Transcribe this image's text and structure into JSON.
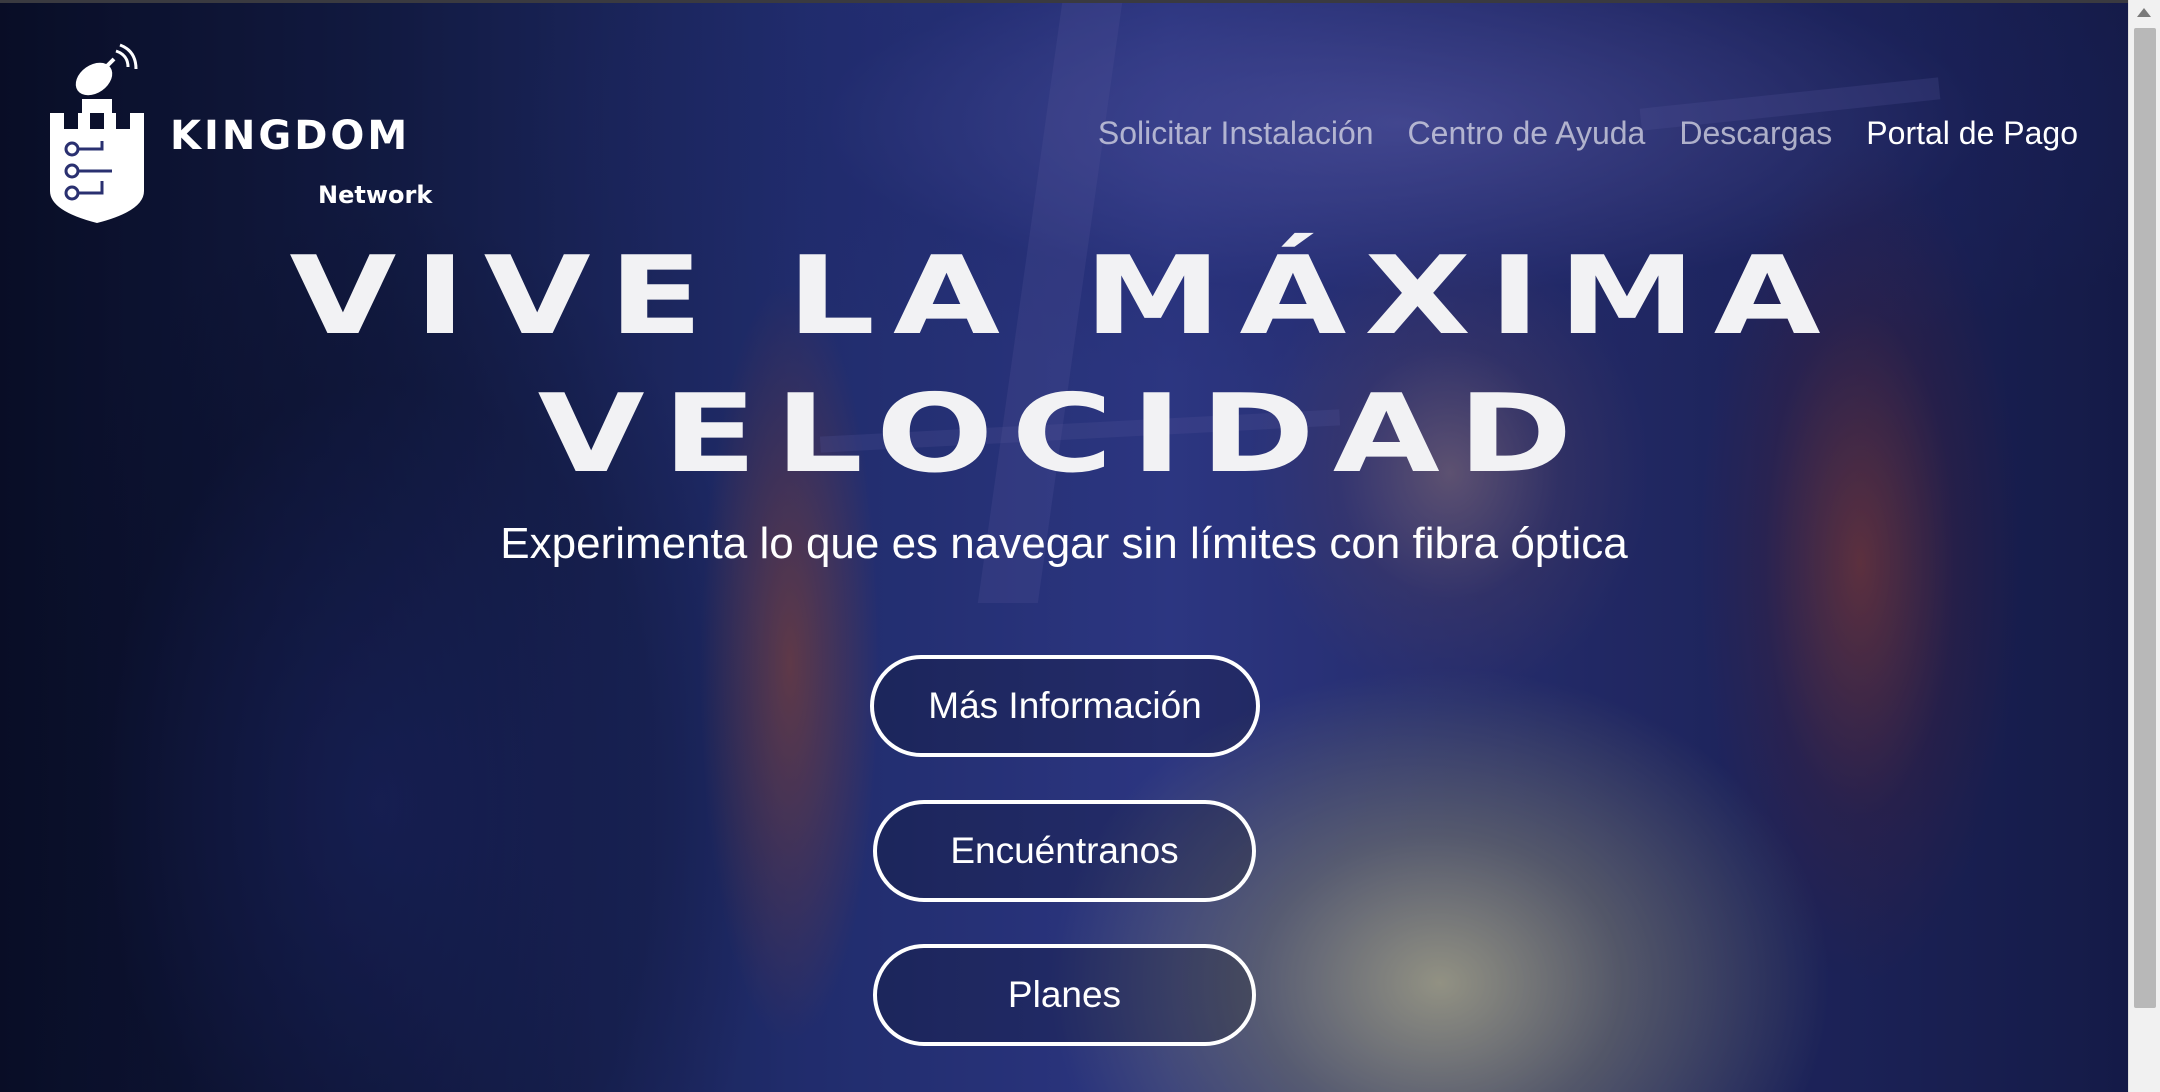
{
  "brand": {
    "name": "KINGDOM",
    "sub": "Network"
  },
  "nav": {
    "items": [
      {
        "label": "Solicitar Instalación"
      },
      {
        "label": "Centro de Ayuda"
      },
      {
        "label": "Descargas"
      },
      {
        "label": "Portal de Pago"
      }
    ]
  },
  "hero": {
    "line1": "VIVE LA MÁXIMA",
    "line2": "VELOCIDAD",
    "subtitle": "Experimenta lo que es navegar sin límites con fibra óptica",
    "buttons": [
      {
        "label": "Más Información"
      },
      {
        "label": "Encuéntranos"
      },
      {
        "label": "Planes"
      }
    ]
  },
  "colors": {
    "text": "#ffffff",
    "nav_inactive": "#e1e1eb",
    "overlay": "#080a1e"
  }
}
